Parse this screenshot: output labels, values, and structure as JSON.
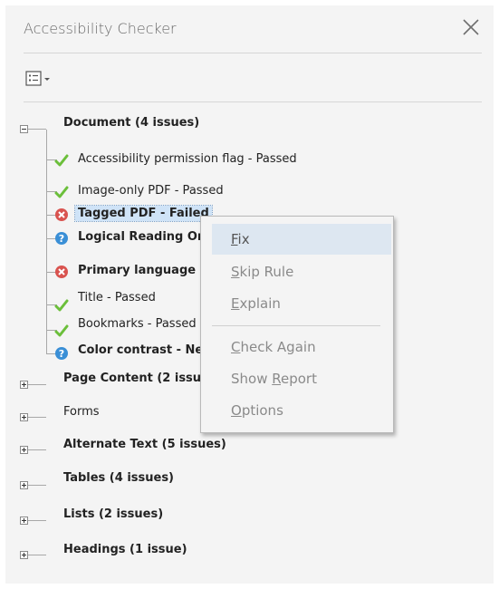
{
  "panel": {
    "title": "Accessibility Checker"
  },
  "tree": {
    "document": {
      "label": "Document (4 issues)",
      "children": [
        {
          "label": "Accessibility permission flag - Passed",
          "status": "passed"
        },
        {
          "label": "Image-only PDF - Passed",
          "status": "passed"
        },
        {
          "label": "Tagged PDF - Failed",
          "status": "failed"
        },
        {
          "label": "Logical Reading Or",
          "status": "needs-check"
        },
        {
          "label": "Primary language -",
          "status": "failed"
        },
        {
          "label": "Title - Passed",
          "status": "passed"
        },
        {
          "label": "Bookmarks - Passed",
          "status": "passed"
        },
        {
          "label": "Color contrast - Ne",
          "status": "needs-check"
        }
      ]
    },
    "categories": [
      {
        "label": "Page Content (2 issue"
      },
      {
        "label": "Forms"
      },
      {
        "label": "Alternate Text (5 issues)"
      },
      {
        "label": "Tables (4 issues)"
      },
      {
        "label": "Lists (2 issues)"
      },
      {
        "label": "Headings (1 issue)"
      }
    ]
  },
  "context_menu": {
    "fix": {
      "pre": "",
      "ul": "F",
      "post": "ix"
    },
    "skip": {
      "pre": "",
      "ul": "S",
      "post": "kip Rule"
    },
    "explain": {
      "pre": "",
      "ul": "E",
      "post": "xplain"
    },
    "check_again": {
      "pre": "",
      "ul": "C",
      "post": "heck Again"
    },
    "show_report": {
      "pre": "Show ",
      "ul": "R",
      "post": "eport"
    },
    "options": {
      "pre": "",
      "ul": "O",
      "post": "ptions"
    }
  },
  "colors": {
    "passed": "#6bbf3a",
    "failed": "#d9534f",
    "needs-check": "#3a8fd6",
    "selection": "#cfe3f7",
    "menu_highlight": "#dde7f1"
  },
  "icons": {
    "close": "close-icon",
    "options": "options-menu-icon",
    "passed": "checkmark-icon",
    "failed": "error-icon",
    "needs-check": "question-icon"
  }
}
